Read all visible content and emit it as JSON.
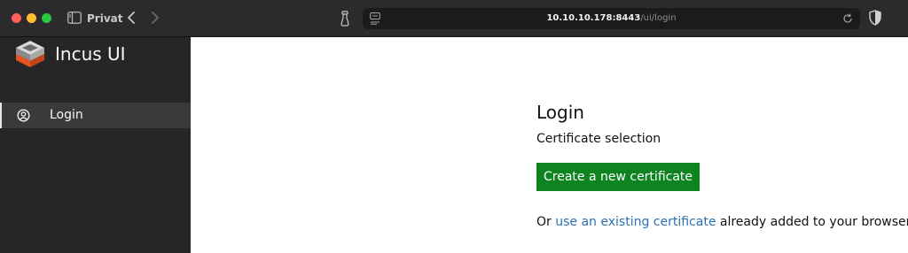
{
  "browser": {
    "profile_label": "Privat",
    "url_host": "10.10.10.178:8443",
    "url_path": "/ui/login"
  },
  "sidebar": {
    "app_name": "Incus UI",
    "items": [
      {
        "label": "Login",
        "icon": "user-icon",
        "active": true
      }
    ]
  },
  "main": {
    "title": "Login",
    "subtitle": "Certificate selection",
    "primary_button": "Create a new certificate",
    "hint_prefix": "Or ",
    "hint_link": "use an existing certificate",
    "hint_suffix": " already added to your browser"
  },
  "colors": {
    "accent_button": "#0e8420",
    "link": "#2a70b0",
    "sidebar_bg": "#262626",
    "sidebar_active_bg": "#3a3a3a",
    "chrome_bg": "#2b2b2d",
    "logo_orange": "#e95420"
  }
}
